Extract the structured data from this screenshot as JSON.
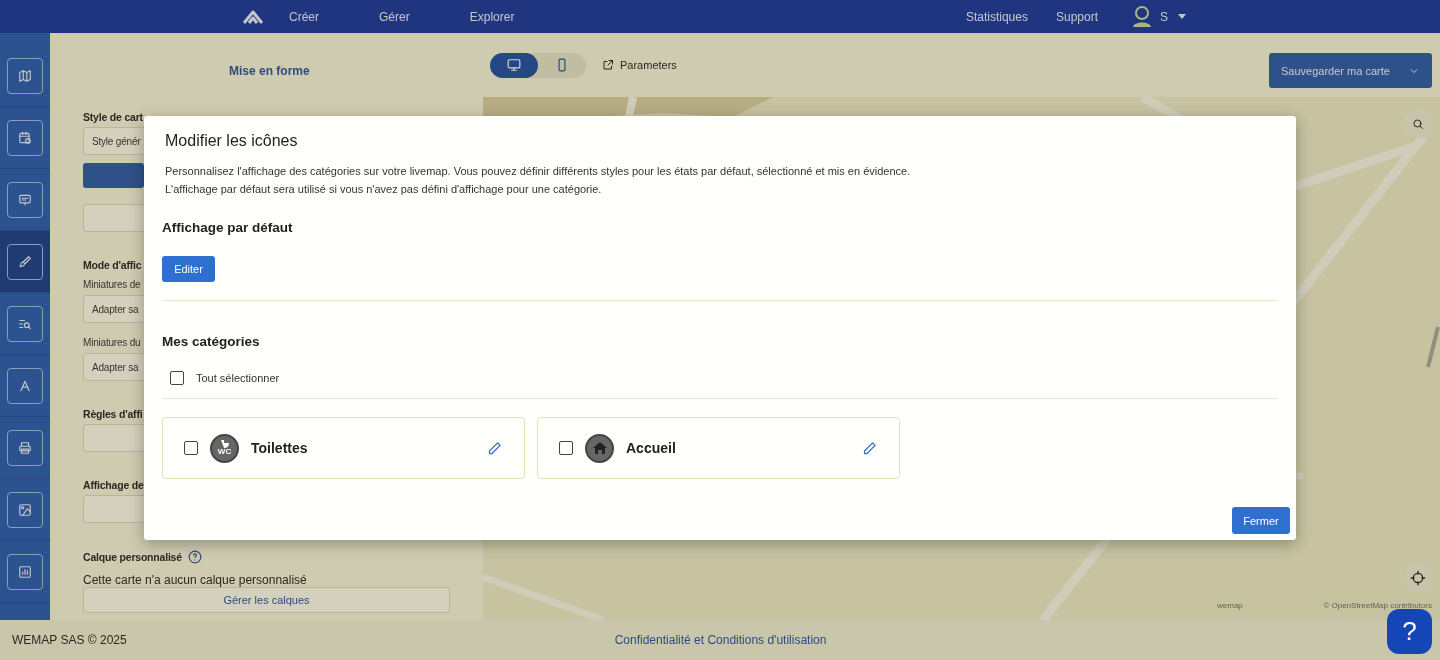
{
  "top_nav": {
    "menu": [
      "Créer",
      "Gérer",
      "Explorer"
    ],
    "right": [
      "Statistiques",
      "Support"
    ],
    "user": "S"
  },
  "rail": [
    {
      "selected": false
    },
    {
      "selected": false
    },
    {
      "selected": false
    },
    {
      "selected": true
    },
    {
      "selected": false
    },
    {
      "selected": false
    },
    {
      "selected": false
    },
    {
      "selected": false
    },
    {
      "selected": false
    }
  ],
  "sidebar": {
    "title": "Mise en forme",
    "items": [
      {
        "kind": "heading",
        "text": "Style de cart"
      },
      {
        "kind": "field",
        "text": "Style génér"
      },
      {
        "kind": "bar"
      },
      {
        "kind": "field"
      },
      {
        "kind": "heading",
        "text": "Mode d'affic"
      },
      {
        "kind": "label",
        "text": "Miniatures de"
      },
      {
        "kind": "field",
        "text": "Adapter sa"
      },
      {
        "kind": "label",
        "text": "Miniatures du"
      },
      {
        "kind": "field",
        "text": "Adapter sa"
      },
      {
        "kind": "heading",
        "text": "Règles d'affi"
      },
      {
        "kind": "field"
      },
      {
        "kind": "heading",
        "text": "Affichage de"
      },
      {
        "kind": "field"
      },
      {
        "kind": "help_heading",
        "text": "Calque personnalisé"
      },
      {
        "kind": "text",
        "text": "Cette carte n'a aucun calque personnalisé"
      },
      {
        "kind": "button",
        "text": "Gérer les calques"
      }
    ]
  },
  "view_toggle": [
    {
      "kind": "desktop",
      "selected": true
    },
    {
      "kind": "mobile",
      "selected": false
    }
  ],
  "parameters_link": "Parameters",
  "save_button": "Sauvegarder ma carte",
  "map": {
    "kind": "picture",
    "brand": "wemap",
    "attribution": "© OpenStreetMap contributors"
  },
  "modal": {
    "title": "Modifier les icônes",
    "description": [
      "Personnalisez l'affichage des catégories sur votre livemap. Vous pouvez définir différents styles pour les états par défaut, sélectionné et mis en évidence.",
      "L'affichage par défaut sera utilisé si vous n'avez pas défini d'affichage pour une catégorie."
    ],
    "default_heading": "Affichage par défaut",
    "edit_button": "Editer",
    "categories_heading": "Mes catégories",
    "select_all": {
      "label": "Tout sélectionner",
      "checked": false
    },
    "categories": [
      {
        "kind": "wc",
        "name": "Toilettes",
        "checked": false,
        "badge": "WC"
      },
      {
        "kind": "home",
        "name": "Accueil",
        "checked": false
      }
    ],
    "close_button": "Fermer"
  },
  "footer": {
    "copyright": "WEMAP SAS © 2025",
    "link": "Confidentialité et Conditions d'utilisation"
  },
  "help_button": "?"
}
